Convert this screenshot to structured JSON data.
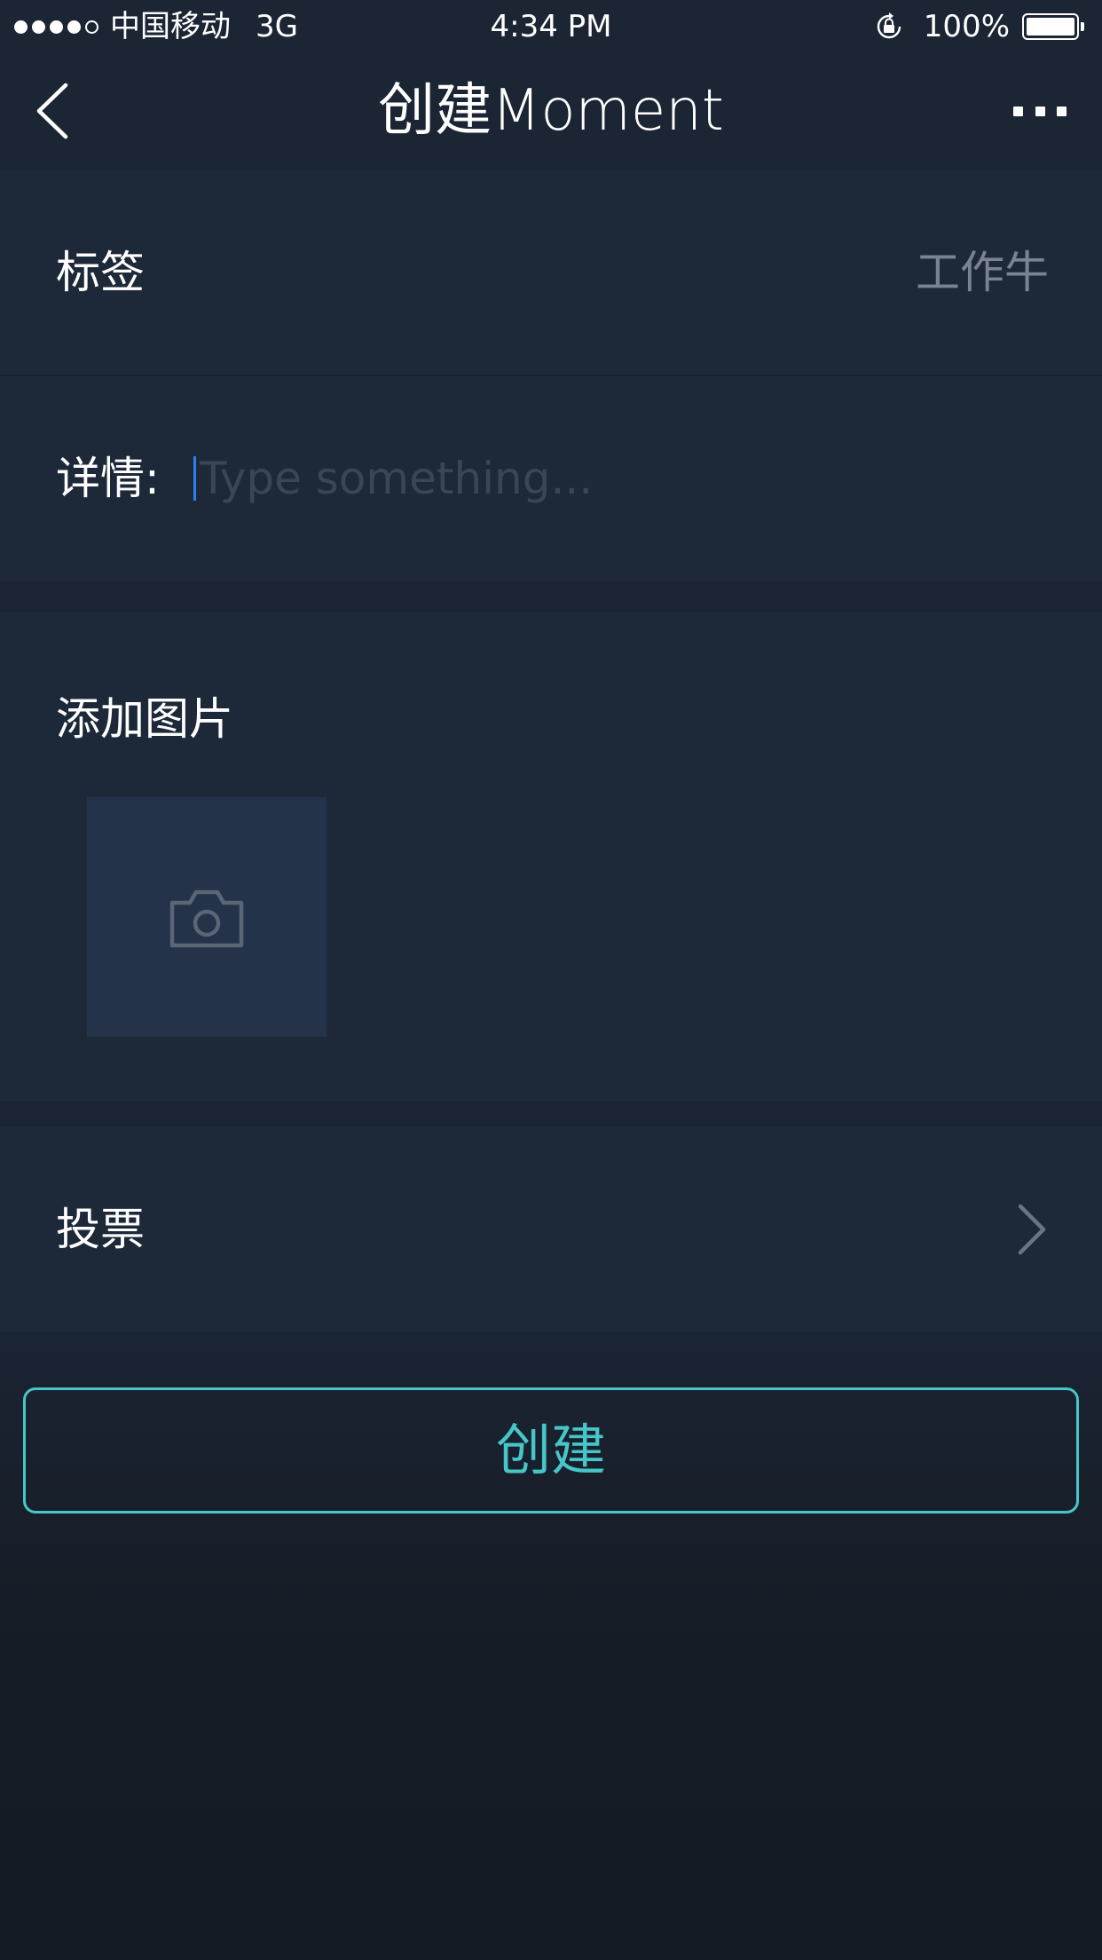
{
  "status_bar": {
    "carrier": "中国移动",
    "network": "3G",
    "time": "4:34 PM",
    "battery": "100%"
  },
  "nav": {
    "title": "创建Moment",
    "back_icon": "chevron-left-icon",
    "more_icon": "ellipsis-icon"
  },
  "tag": {
    "label": "标签",
    "value": "工作牛"
  },
  "detail": {
    "label": "详情:",
    "value": "",
    "placeholder": "Type something..."
  },
  "photos": {
    "label": "添加图片",
    "add_icon": "camera-icon"
  },
  "vote": {
    "label": "投票",
    "icon": "chevron-right-icon"
  },
  "create_button": {
    "label": "创建"
  },
  "colors": {
    "background": "#1c2534",
    "row_background": "#1d2939",
    "accent": "#46c6c8",
    "muted_text": "#7b8391",
    "caret": "#2f7df6"
  }
}
